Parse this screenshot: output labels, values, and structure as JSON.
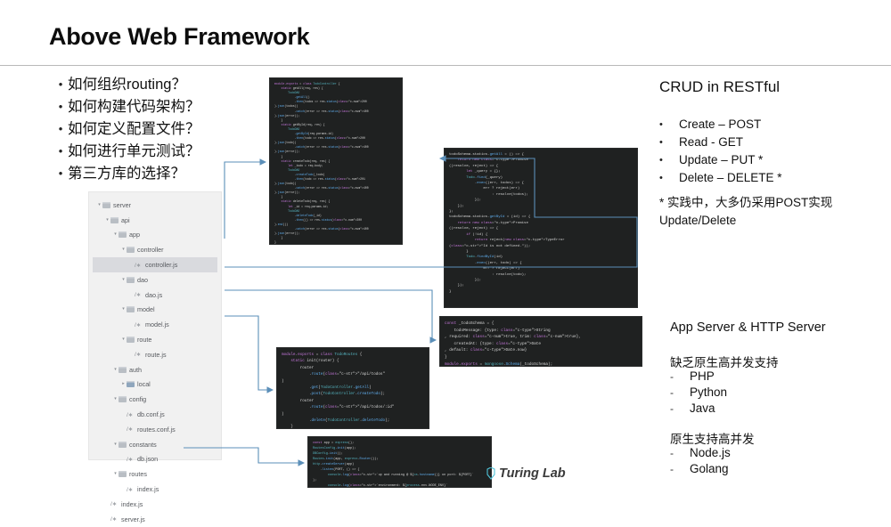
{
  "slide": {
    "title": "Above Web Framework",
    "logo": "Turing Lab"
  },
  "questions": [
    {
      "bullet": "•",
      "text": "如何组织routing？"
    },
    {
      "bullet": "•",
      "text": "如何构建代码架构？"
    },
    {
      "bullet": "•",
      "text": "如何定义配置文件？"
    },
    {
      "bullet": "•",
      "text": "如何进行单元测试？"
    },
    {
      "bullet": "•",
      "text": "第三方库的选择？"
    }
  ],
  "file_tree": [
    {
      "depth": 0,
      "arrow": "▾",
      "kind": "folder",
      "label": "server",
      "selected": false
    },
    {
      "depth": 1,
      "arrow": "▾",
      "kind": "folder",
      "label": "api",
      "selected": false
    },
    {
      "depth": 2,
      "arrow": "▾",
      "kind": "folder",
      "label": "app",
      "selected": false
    },
    {
      "depth": 3,
      "arrow": "▾",
      "kind": "folder",
      "label": "controller",
      "selected": false
    },
    {
      "depth": 4,
      "arrow": "",
      "kind": "js",
      "label": "controller.js",
      "selected": true
    },
    {
      "depth": 3,
      "arrow": "▾",
      "kind": "folder",
      "label": "dao",
      "selected": false
    },
    {
      "depth": 4,
      "arrow": "",
      "kind": "js",
      "label": "dao.js",
      "selected": false
    },
    {
      "depth": 3,
      "arrow": "▾",
      "kind": "folder",
      "label": "model",
      "selected": false
    },
    {
      "depth": 4,
      "arrow": "",
      "kind": "js",
      "label": "model.js",
      "selected": false
    },
    {
      "depth": 3,
      "arrow": "▾",
      "kind": "folder",
      "label": "route",
      "selected": false
    },
    {
      "depth": 4,
      "arrow": "",
      "kind": "js",
      "label": "route.js",
      "selected": false
    },
    {
      "depth": 2,
      "arrow": "▾",
      "kind": "folder",
      "label": "auth",
      "selected": false
    },
    {
      "depth": 3,
      "arrow": "▸",
      "kind": "folderblue",
      "label": "local",
      "selected": false
    },
    {
      "depth": 2,
      "arrow": "▾",
      "kind": "folder",
      "label": "config",
      "selected": false
    },
    {
      "depth": 3,
      "arrow": "",
      "kind": "js",
      "label": "db.conf.js",
      "selected": false
    },
    {
      "depth": 3,
      "arrow": "",
      "kind": "js",
      "label": "routes.conf.js",
      "selected": false
    },
    {
      "depth": 2,
      "arrow": "▾",
      "kind": "folder",
      "label": "constants",
      "selected": false
    },
    {
      "depth": 3,
      "arrow": "",
      "kind": "js",
      "label": "db.json",
      "selected": false
    },
    {
      "depth": 2,
      "arrow": "▾",
      "kind": "folder",
      "label": "routes",
      "selected": false
    },
    {
      "depth": 3,
      "arrow": "",
      "kind": "js",
      "label": "index.js",
      "selected": false
    },
    {
      "depth": 1,
      "arrow": "",
      "kind": "js",
      "label": "index.js",
      "selected": false
    },
    {
      "depth": 1,
      "arrow": "",
      "kind": "js",
      "label": "server.js",
      "selected": false
    }
  ],
  "code_blocks": {
    "controller": {
      "filename": "controller.js",
      "lines": [
        "module.exports = class TodoController {",
        "    static getAll(req, res) {",
        "        TodoDAO",
        "            .getAll()",
        "            .then(todos => res.status(200).json(todos))",
        "            .catch(error => res.status(400).json(error));",
        "    }",
        "",
        "    static getById(req, res) {",
        "        TodoDAO",
        "            .getById(req.params.id)",
        "            .then(todo => res.status(200).json(todo))",
        "            .catch(error => res.status(400).json(error));",
        "    }",
        "",
        "    static createTodo(req, res) {",
        "        let _todo = req.body;",
        "",
        "        TodoDAO",
        "            .createTodo(_todo)",
        "            .then(todo => res.status(201).json(todo))",
        "            .catch(error => res.status(400).json(error));",
        "    }",
        "",
        "    static deleteTodo(req, res) {",
        "        let _id = req.params.id;",
        "",
        "        TodoDAO",
        "            .deleteTodo(_id)",
        "            .then(() => res.status(200).end())",
        "            .catch(error => res.status(400).json(error));",
        "    }",
        "}"
      ]
    },
    "dao": {
      "filename": "dao.js",
      "lines": [
        "todoSchema.statics.getAll = () => {",
        "    return new Promise((resolve, reject) => {",
        "        let _query = {};",
        "",
        "        Todo.find(_query)",
        "            .exec((err, todos) => {",
        "                err ? reject(err)",
        "                    : resolve(todos);",
        "            });",
        "    });",
        "};",
        "",
        "todoSchema.statics.getById = (id) => {",
        "    return new Promise((resolve, reject) => {",
        "        if (!id) {",
        "            return reject(new TypeError(\"Id is not defined.\"));",
        "        }",
        "",
        "        Todo.findById(id)",
        "            .exec((err, todo) => {",
        "                err ? reject(err)",
        "                    : resolve(todo);",
        "            });",
        "    });",
        "}"
      ]
    },
    "schema": {
      "filename": "model.js",
      "lines": [
        "const _todoSchema = {",
        "    todoMessage: {type: String, required: true, trim: true},",
        "    createdAt: {type: Date, default: Date.now}",
        "}",
        "",
        "module.exports = mongoose.Schema(_todoSchema);"
      ]
    },
    "routes": {
      "filename": "route.js",
      "lines": [
        "module.exports = class TodoRoutes {",
        "    static init(router) {",
        "        router",
        "            .route(\"/api/todos\")",
        "            .get(TodoController.getAll)",
        "            .post(TodoController.createTodo);",
        "",
        "        router",
        "            .route(\"/api/todos/:id\")",
        "            .delete(TodoController.deleteTodo);",
        "    }",
        "}"
      ]
    },
    "server": {
      "filename": "server.js",
      "lines": [
        "const app = express();",
        "",
        "RoutesConfig.init(app);",
        "DBConfig.init();",
        "Routes.init(app, express.Router());",
        "",
        "http.createServer(app)",
        "    .listen(PORT, () => {",
        "        console.log(`up and running @ ${os.hostname()} on port: ${PORT}`);",
        "        console.log(`environment: ${process.env.NODE_ENV}`);",
        "    });"
      ]
    }
  },
  "crud": {
    "title": "CRUD in RESTful",
    "items": [
      {
        "bullet": "•",
        "text": "Create – POST"
      },
      {
        "bullet": "•",
        "text": "Read - GET"
      },
      {
        "bullet": "•",
        "text": "Update – PUT *"
      },
      {
        "bullet": "•",
        "text": "Delete – DELETE *"
      }
    ],
    "note": "* 实践中，大多仍采用POST实现 Update/Delete"
  },
  "server_section": {
    "title": "App Server & HTTP Server",
    "group1": {
      "heading": "缺乏原生高并发支持",
      "items": [
        {
          "dash": "-",
          "text": "PHP"
        },
        {
          "dash": "-",
          "text": "Python"
        },
        {
          "dash": "-",
          "text": "Java"
        }
      ]
    },
    "group2": {
      "heading": "原生支持高并发",
      "items": [
        {
          "dash": "-",
          "text": "Node.js"
        },
        {
          "dash": "-",
          "text": "Golang"
        }
      ]
    }
  },
  "colors": {
    "connector": "#5b8fb9",
    "code_bg": "#1f2121",
    "tree_bg": "#f1f1f1",
    "rule": "#b9b9b9"
  }
}
